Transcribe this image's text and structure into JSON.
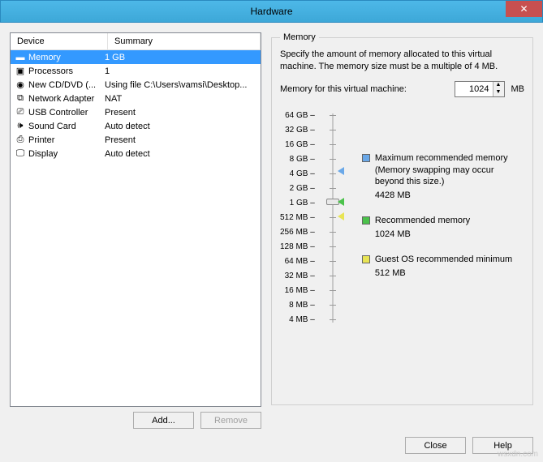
{
  "window": {
    "title": "Hardware"
  },
  "list": {
    "headers": {
      "device": "Device",
      "summary": "Summary"
    },
    "rows": [
      {
        "icon": "memory-icon",
        "glyph": "▬",
        "device": "Memory",
        "summary": "1 GB",
        "selected": true
      },
      {
        "icon": "cpu-icon",
        "glyph": "▣",
        "device": "Processors",
        "summary": "1"
      },
      {
        "icon": "cd-icon",
        "glyph": "◉",
        "device": "New CD/DVD (...",
        "summary": "Using file C:\\Users\\vamsi\\Desktop..."
      },
      {
        "icon": "network-icon",
        "glyph": "⧉",
        "device": "Network Adapter",
        "summary": "NAT"
      },
      {
        "icon": "usb-icon",
        "glyph": "⎚",
        "device": "USB Controller",
        "summary": "Present"
      },
      {
        "icon": "sound-icon",
        "glyph": "🕪",
        "device": "Sound Card",
        "summary": "Auto detect"
      },
      {
        "icon": "printer-icon",
        "glyph": "⎙",
        "device": "Printer",
        "summary": "Present"
      },
      {
        "icon": "display-icon",
        "glyph": "🖵",
        "device": "Display",
        "summary": "Auto detect"
      }
    ]
  },
  "buttons": {
    "add": "Add...",
    "remove": "Remove",
    "close": "Close",
    "help": "Help"
  },
  "memory": {
    "legend": "Memory",
    "desc": "Specify the amount of memory allocated to this virtual machine. The memory size must be a multiple of 4 MB.",
    "label": "Memory for this virtual machine:",
    "value": "1024",
    "unit": "MB",
    "ticks": [
      "64 GB",
      "32 GB",
      "16 GB",
      "8 GB",
      "4 GB",
      "2 GB",
      "1 GB",
      "512 MB",
      "256 MB",
      "128 MB",
      "64 MB",
      "32 MB",
      "16 MB",
      "8 MB",
      "4 MB"
    ],
    "legend_items": {
      "max": {
        "title": "Maximum recommended memory",
        "note": "(Memory swapping may occur beyond this size.)",
        "value": "4428 MB",
        "color": "#6aa8e8"
      },
      "rec": {
        "title": "Recommended memory",
        "value": "1024 MB",
        "color": "#4bc24b"
      },
      "min": {
        "title": "Guest OS recommended minimum",
        "value": "512 MB",
        "color": "#e8e454"
      }
    }
  },
  "watermark": "wsxdn.com"
}
